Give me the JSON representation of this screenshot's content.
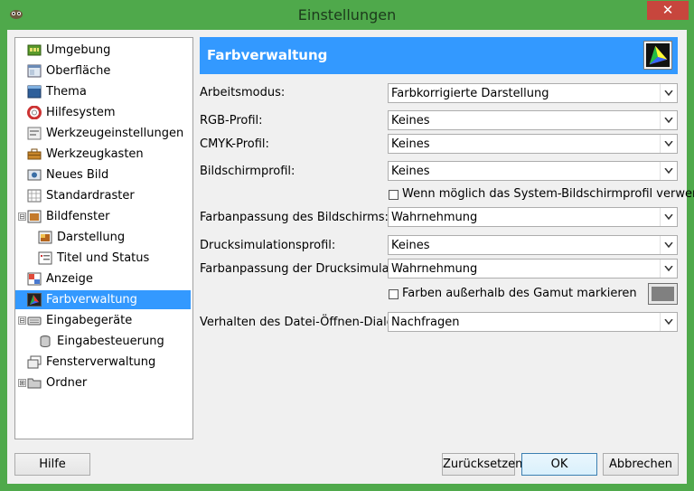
{
  "window": {
    "title": "Einstellungen",
    "close_glyph": "✕",
    "app_icon": "gimp-icon"
  },
  "tree": {
    "items": [
      {
        "label": "Umgebung",
        "icon": "environment-icon",
        "selected": false
      },
      {
        "label": "Oberfläche",
        "icon": "interface-icon",
        "selected": false
      },
      {
        "label": "Thema",
        "icon": "theme-icon",
        "selected": false
      },
      {
        "label": "Hilfesystem",
        "icon": "help-system-icon",
        "selected": false
      },
      {
        "label": "Werkzeugeinstellungen",
        "icon": "tool-options-icon",
        "selected": false
      },
      {
        "label": "Werkzeugkasten",
        "icon": "toolbox-icon",
        "selected": false
      },
      {
        "label": "Neues Bild",
        "icon": "new-image-icon",
        "selected": false
      },
      {
        "label": "Standardraster",
        "icon": "grid-icon",
        "selected": false
      },
      {
        "label": "Bildfenster",
        "icon": "image-window-icon",
        "selected": false,
        "expander": "⊟"
      },
      {
        "label": "Darstellung",
        "icon": "appearance-icon",
        "selected": false
      },
      {
        "label": "Titel und Status",
        "icon": "title-status-icon",
        "selected": false
      },
      {
        "label": "Anzeige",
        "icon": "display-icon",
        "selected": false
      },
      {
        "label": "Farbverwaltung",
        "icon": "color-management-icon",
        "selected": true
      },
      {
        "label": "Eingabegeräte",
        "icon": "input-devices-icon",
        "selected": false,
        "expander": "⊟"
      },
      {
        "label": "Eingabesteuerung",
        "icon": "input-controllers-icon",
        "selected": false
      },
      {
        "label": "Fensterverwaltung",
        "icon": "window-management-icon",
        "selected": false
      },
      {
        "label": "Ordner",
        "icon": "folders-icon",
        "selected": false,
        "expander": "⊞"
      }
    ]
  },
  "panel": {
    "title": "Farbverwaltung",
    "icon": "color-management-icon"
  },
  "form": {
    "arbeitsmodus": {
      "label": "Arbeitsmodus:",
      "value": "Farbkorrigierte Darstellung"
    },
    "rgb": {
      "label": "RGB-Profil:",
      "value": "Keines"
    },
    "cmyk": {
      "label": "CMYK-Profil:",
      "value": "Keines"
    },
    "bildschirm": {
      "label": "Bildschirmprofil:",
      "value": "Keines"
    },
    "system_profil": {
      "label": "Wenn möglich das System-Bildschirmprofil verwenden",
      "checked": false
    },
    "farbanpassung_bild": {
      "label": "Farbanpassung des Bildschirms:",
      "value": "Wahrnehmung"
    },
    "drucksim": {
      "label": "Drucksimulationsprofil:",
      "value": "Keines"
    },
    "farbanpassung_druck": {
      "label": "Farbanpassung der Drucksimulation:",
      "value": "Wahrnehmung"
    },
    "gamut": {
      "label": "Farben außerhalb des Gamut markieren",
      "checked": false,
      "color": "#808080"
    },
    "dialog": {
      "label": "Verhalten des Datei-Öffnen-Dialogs:",
      "value": "Nachfragen"
    }
  },
  "buttons": {
    "help": "Hilfe",
    "reset": "Zurücksetzen",
    "ok": "OK",
    "cancel": "Abbrechen"
  },
  "colors": {
    "titlebar": "#4fa94b",
    "selection": "#3399ff",
    "close": "#c7463d"
  }
}
